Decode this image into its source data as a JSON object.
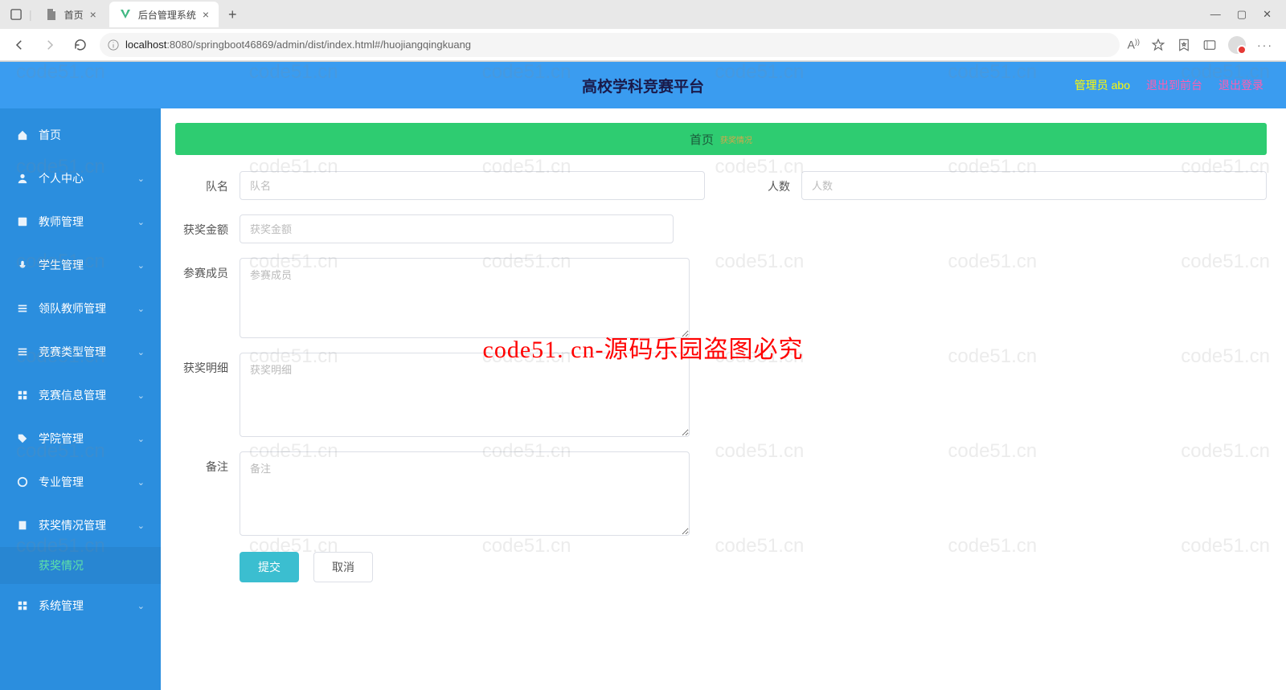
{
  "browser": {
    "tabs": [
      {
        "title": "首页",
        "active": false
      },
      {
        "title": "后台管理系统",
        "active": true
      }
    ],
    "url_host": "localhost",
    "url_path": ":8080/springboot46869/admin/dist/index.html#/huojiangqingkuang"
  },
  "header": {
    "title": "高校学科竞赛平台",
    "admin_label": "管理员 abo",
    "front_link": "退出到前台",
    "logout_link": "退出登录"
  },
  "sidebar": {
    "items": [
      {
        "key": "home",
        "label": "首页",
        "icon": "home",
        "expandable": false
      },
      {
        "key": "personal",
        "label": "个人中心",
        "icon": "user",
        "expandable": true
      },
      {
        "key": "teacher",
        "label": "教师管理",
        "icon": "book",
        "expandable": true
      },
      {
        "key": "student",
        "label": "学生管理",
        "icon": "mic",
        "expandable": true
      },
      {
        "key": "lead-teacher",
        "label": "领队教师管理",
        "icon": "list",
        "expandable": true
      },
      {
        "key": "comp-type",
        "label": "竞赛类型管理",
        "icon": "list",
        "expandable": true
      },
      {
        "key": "comp-info",
        "label": "竞赛信息管理",
        "icon": "grid",
        "expandable": true
      },
      {
        "key": "college",
        "label": "学院管理",
        "icon": "tag",
        "expandable": true
      },
      {
        "key": "major",
        "label": "专业管理",
        "icon": "circle",
        "expandable": true
      },
      {
        "key": "award",
        "label": "获奖情况管理",
        "icon": "doc",
        "expandable": true,
        "expanded": true,
        "sub": "获奖情况"
      },
      {
        "key": "system",
        "label": "系统管理",
        "icon": "grid",
        "expandable": true
      }
    ]
  },
  "breadcrumb": {
    "root": "首页",
    "extra": "获奖情况"
  },
  "form": {
    "team_name": {
      "label": "队名",
      "placeholder": "队名",
      "value": ""
    },
    "headcount": {
      "label": "人数",
      "placeholder": "人数",
      "value": ""
    },
    "amount": {
      "label": "获奖金额",
      "placeholder": "获奖金额",
      "value": ""
    },
    "members": {
      "label": "参赛成员",
      "placeholder": "参赛成员",
      "value": ""
    },
    "detail": {
      "label": "获奖明细",
      "placeholder": "获奖明细",
      "value": ""
    },
    "note": {
      "label": "备注",
      "placeholder": "备注",
      "value": ""
    },
    "submit": "提交",
    "cancel": "取消"
  },
  "watermark": "code51.cn",
  "overlay": "code51. cn-源码乐园盗图必究"
}
